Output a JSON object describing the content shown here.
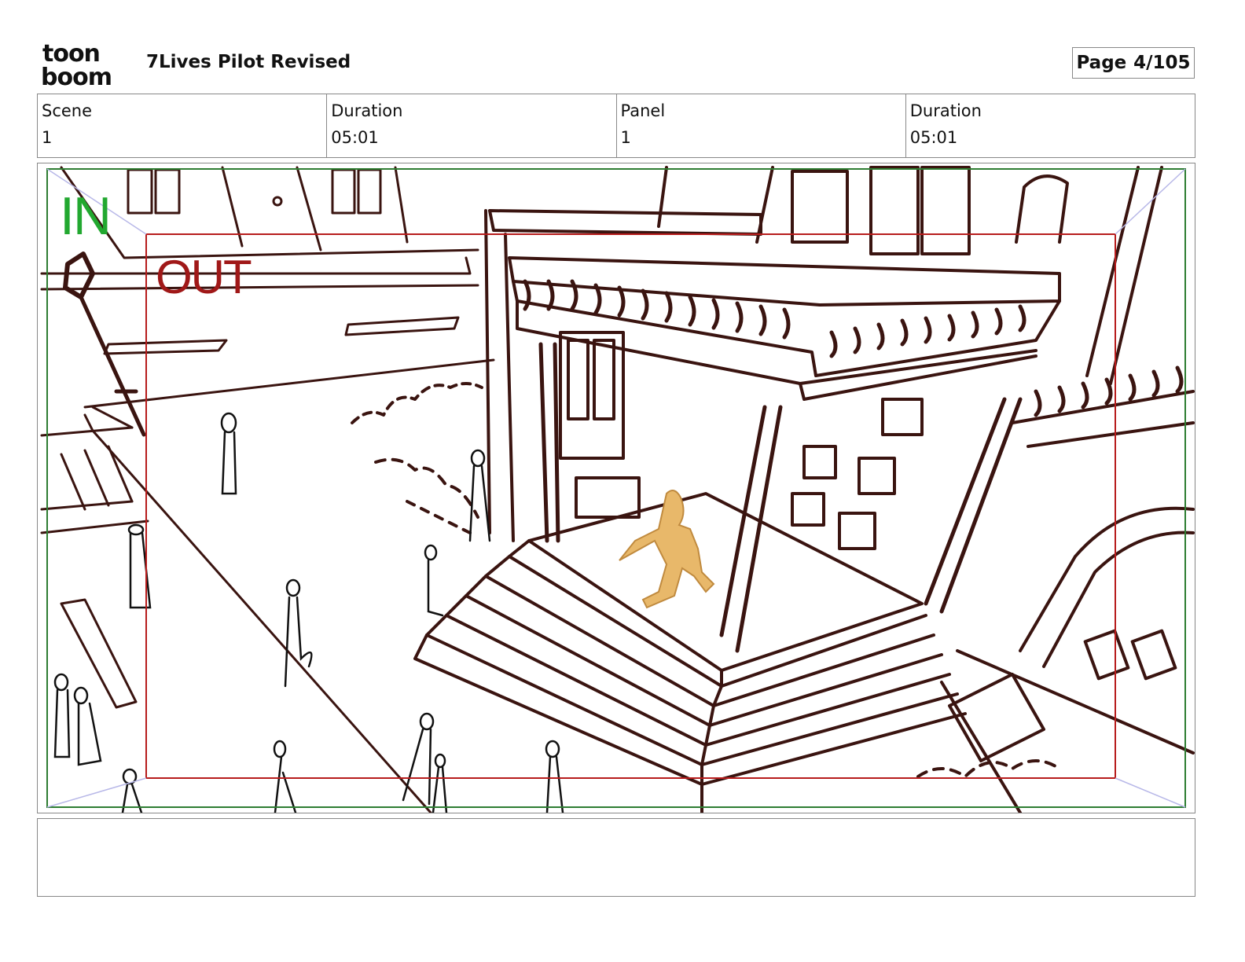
{
  "header": {
    "logo": {
      "line1": "toon",
      "line2": "boom"
    },
    "project_title": "7Lives Pilot Revised",
    "page": {
      "label": "Page",
      "value": "4/105"
    }
  },
  "info": {
    "scene_label": "Scene",
    "scene_value": "1",
    "scene_duration_label": "Duration",
    "scene_duration_value": "05:01",
    "panel_label": "Panel",
    "panel_value": "1",
    "panel_duration_label": "Duration",
    "panel_duration_value": "05:01"
  },
  "panel": {
    "in_label": "IN",
    "out_label": "OUT",
    "colors": {
      "line": "#3a1410",
      "in_frame": "#2e7d32",
      "out_frame": "#b71c1c",
      "character": "#e8b86a",
      "figures": "#111111",
      "guides": "#b8b8e8"
    }
  },
  "notes": {
    "text": ""
  }
}
